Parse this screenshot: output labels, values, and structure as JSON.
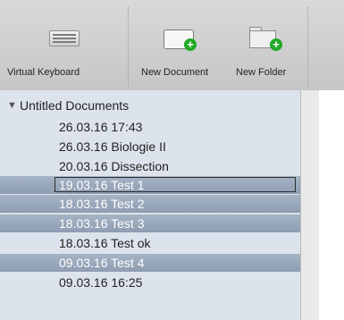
{
  "toolbar": {
    "virtual_keyboard": "Virtual Keyboard",
    "new_document": "New Document",
    "new_folder": "New Folder"
  },
  "sidebar": {
    "root": "Untitled Documents",
    "items": [
      {
        "label": "26.03.16 17:43"
      },
      {
        "label": "26.03.16 Biologie II"
      },
      {
        "label": "20.03.16 Dissection"
      },
      {
        "label": "19.03.16 Test 1"
      },
      {
        "label": "18.03.16 Test 2"
      },
      {
        "label": "18.03.16 Test 3"
      },
      {
        "label": "18.03.16 Test ok"
      },
      {
        "label": "09.03.16 Test 4"
      },
      {
        "label": "09.03.16 16:25"
      }
    ]
  },
  "colors": {
    "selection": "#98a7bb",
    "sidebar_bg": "#dce3ec",
    "plus_badge": "#23a827"
  },
  "icons": {
    "keyboard": "keyboard-icon",
    "document": "new-document-icon",
    "folder": "new-folder-icon",
    "disclosure": "disclosure-triangle-icon"
  }
}
